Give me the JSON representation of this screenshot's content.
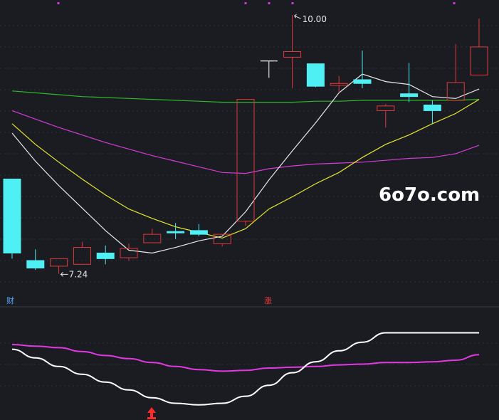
{
  "chart_data": {
    "type": "candlestick",
    "colors": {
      "background": "#1a1c22",
      "up": "#e03a3a",
      "down": "#4ff0f4",
      "doji": "#ffffff",
      "ma_fast": "#e8e8e8",
      "ma_mid": "#e6e62c",
      "ma_slow_1": "#d63bd6",
      "ma_slow_2": "#2db82d",
      "osc_white": "#ffffff",
      "osc_magenta": "#e238e2",
      "marker": "#ff2a2a",
      "grid": "#2c3038",
      "separator": "#3a3d45"
    },
    "price_ylim": [
      7.0,
      10.1
    ],
    "candles": [
      {
        "o": 8.25,
        "h": 8.25,
        "l": 7.4,
        "c": 7.46
      },
      {
        "o": 7.38,
        "h": 7.5,
        "l": 7.28,
        "c": 7.3
      },
      {
        "o": 7.32,
        "h": 7.4,
        "l": 7.24,
        "c": 7.4
      },
      {
        "o": 7.34,
        "h": 7.58,
        "l": 7.34,
        "c": 7.52
      },
      {
        "o": 7.46,
        "h": 7.54,
        "l": 7.34,
        "c": 7.4
      },
      {
        "o": 7.41,
        "h": 7.56,
        "l": 7.38,
        "c": 7.51
      },
      {
        "o": 7.57,
        "h": 7.72,
        "l": 7.57,
        "c": 7.66
      },
      {
        "o": 7.69,
        "h": 7.78,
        "l": 7.61,
        "c": 7.68
      },
      {
        "o": 7.7,
        "h": 7.77,
        "l": 7.64,
        "c": 7.66
      },
      {
        "o": 7.56,
        "h": 7.66,
        "l": 7.53,
        "c": 7.66
      },
      {
        "o": 7.8,
        "h": 9.1,
        "l": 7.75,
        "c": 9.1
      },
      {
        "o": 9.51,
        "h": 9.51,
        "l": 9.33,
        "c": 9.51
      },
      {
        "o": 9.55,
        "h": 10.0,
        "l": 9.22,
        "c": 9.61
      },
      {
        "o": 9.48,
        "h": 9.48,
        "l": 9.23,
        "c": 9.24
      },
      {
        "o": 9.25,
        "h": 9.35,
        "l": 9.17,
        "c": 9.27
      },
      {
        "o": 9.31,
        "h": 9.62,
        "l": 9.22,
        "c": 9.27
      },
      {
        "o": 8.98,
        "h": 9.05,
        "l": 8.8,
        "c": 9.03
      },
      {
        "o": 9.16,
        "h": 9.49,
        "l": 9.07,
        "c": 9.13
      },
      {
        "o": 9.04,
        "h": 9.09,
        "l": 8.84,
        "c": 8.98
      },
      {
        "o": 9.09,
        "h": 9.69,
        "l": 9.09,
        "c": 9.28
      },
      {
        "o": 9.36,
        "h": 9.96,
        "l": 9.36,
        "c": 9.66
      }
    ],
    "ma_fast": [
      8.74,
      8.44,
      8.18,
      7.94,
      7.7,
      7.49,
      7.46,
      7.52,
      7.59,
      7.64,
      7.9,
      8.24,
      8.55,
      8.85,
      9.17,
      9.37,
      9.29,
      9.26,
      9.13,
      9.11,
      9.21
    ],
    "ma_mid": [
      8.84,
      8.62,
      8.43,
      8.25,
      8.08,
      7.93,
      7.83,
      7.74,
      7.68,
      7.62,
      7.72,
      7.93,
      8.06,
      8.2,
      8.32,
      8.48,
      8.62,
      8.72,
      8.84,
      8.95,
      9.1
    ],
    "ma_slow_1": [
      8.98,
      8.89,
      8.8,
      8.72,
      8.64,
      8.57,
      8.5,
      8.44,
      8.38,
      8.32,
      8.31,
      8.36,
      8.39,
      8.41,
      8.42,
      8.43,
      8.45,
      8.47,
      8.48,
      8.52,
      8.61
    ],
    "ma_slow_2": [
      9.19,
      9.17,
      9.15,
      9.13,
      9.12,
      9.11,
      9.1,
      9.09,
      9.08,
      9.07,
      9.07,
      9.07,
      9.07,
      9.08,
      9.08,
      9.09,
      9.09,
      9.09,
      9.09,
      9.09,
      9.1
    ],
    "annotations": {
      "high_label": "10.00",
      "low_label": "7.24",
      "marker_left": "财",
      "marker_mid": "涨"
    },
    "oscillator": {
      "ylim": [
        0,
        100
      ],
      "white": [
        74,
        63,
        52,
        42,
        32,
        22,
        12,
        5,
        3,
        5,
        14,
        28,
        44,
        58,
        72,
        83,
        95,
        95,
        95,
        95,
        95
      ],
      "magenta": [
        80,
        78,
        76,
        71,
        66,
        62,
        57,
        52,
        48,
        46,
        47,
        50,
        51,
        52,
        54,
        55,
        57,
        57,
        58,
        60,
        67
      ]
    }
  },
  "watermark": "6o7o.com"
}
